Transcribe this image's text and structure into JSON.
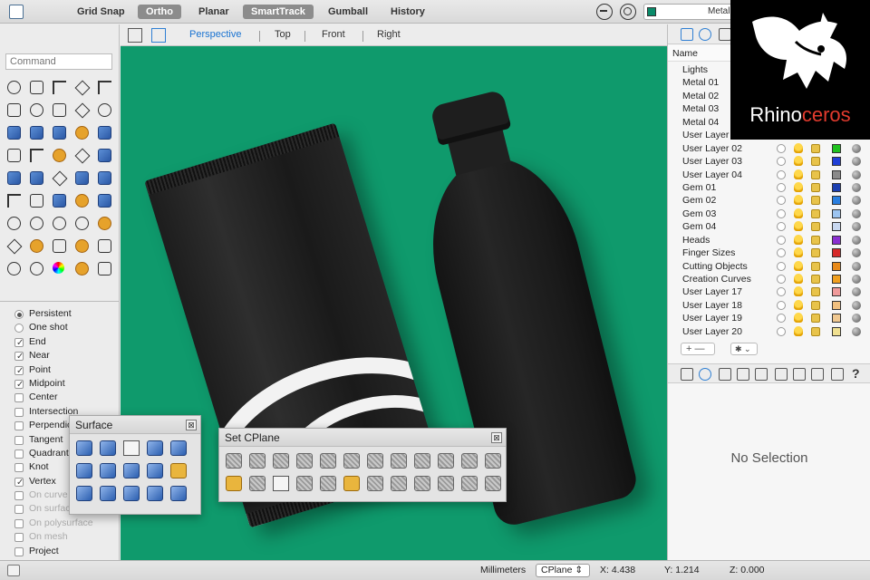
{
  "topbar": {
    "toggles": [
      {
        "label": "Grid Snap",
        "active": false
      },
      {
        "label": "Ortho",
        "active": true
      },
      {
        "label": "Planar",
        "active": false
      },
      {
        "label": "SmartTrack",
        "active": true
      },
      {
        "label": "Gumball",
        "active": false
      },
      {
        "label": "History",
        "active": false
      }
    ],
    "current_layer": "Metal",
    "current_layer_color": "#0a8b6a"
  },
  "command": {
    "placeholder": "Command"
  },
  "viewport_tabs": [
    "Perspective",
    "Top",
    "Front",
    "Right"
  ],
  "active_viewport": "Perspective",
  "osnap": {
    "modes": [
      {
        "label": "Persistent",
        "kind": "radio",
        "selected": true,
        "enabled": true
      },
      {
        "label": "One shot",
        "kind": "radio",
        "selected": false,
        "enabled": true
      },
      {
        "label": "End",
        "kind": "check",
        "selected": true,
        "enabled": true
      },
      {
        "label": "Near",
        "kind": "check",
        "selected": true,
        "enabled": true
      },
      {
        "label": "Point",
        "kind": "check",
        "selected": true,
        "enabled": true
      },
      {
        "label": "Midpoint",
        "kind": "check",
        "selected": true,
        "enabled": true
      },
      {
        "label": "Center",
        "kind": "check",
        "selected": false,
        "enabled": true
      },
      {
        "label": "Intersection",
        "kind": "check",
        "selected": false,
        "enabled": true
      },
      {
        "label": "Perpendicular",
        "kind": "check",
        "selected": false,
        "enabled": true
      },
      {
        "label": "Tangent",
        "kind": "check",
        "selected": false,
        "enabled": true
      },
      {
        "label": "Quadrant",
        "kind": "check",
        "selected": false,
        "enabled": true
      },
      {
        "label": "Knot",
        "kind": "check",
        "selected": false,
        "enabled": true
      },
      {
        "label": "Vertex",
        "kind": "check",
        "selected": true,
        "enabled": true
      },
      {
        "label": "On curve",
        "kind": "check",
        "selected": false,
        "enabled": false
      },
      {
        "label": "On surface",
        "kind": "check",
        "selected": false,
        "enabled": false
      },
      {
        "label": "On polysurface",
        "kind": "check",
        "selected": false,
        "enabled": false
      },
      {
        "label": "On mesh",
        "kind": "check",
        "selected": false,
        "enabled": false
      },
      {
        "label": "Project",
        "kind": "check",
        "selected": false,
        "enabled": true
      }
    ]
  },
  "surface_toolbar": {
    "title": "Surface",
    "close": "⊠"
  },
  "cplane_toolbar": {
    "title": "Set CPlane",
    "close": "⊠"
  },
  "layers": {
    "header": "Name",
    "items": [
      {
        "name": "Lights",
        "color": "",
        "show_controls": false
      },
      {
        "name": "Metal 01",
        "color": "",
        "show_controls": false
      },
      {
        "name": "Metal 02",
        "color": "",
        "show_controls": false
      },
      {
        "name": "Metal 03",
        "color": "",
        "show_controls": false
      },
      {
        "name": "Metal 04",
        "color": "",
        "show_controls": false
      },
      {
        "name": "User Layer 01",
        "color": "",
        "show_controls": false
      },
      {
        "name": "User Layer 02",
        "color": "#1fc21f",
        "show_controls": true
      },
      {
        "name": "User Layer 03",
        "color": "#1f3fd6",
        "show_controls": true
      },
      {
        "name": "User Layer 04",
        "color": "#8a8a8a",
        "show_controls": true
      },
      {
        "name": "Gem 01",
        "color": "#1c3fb0",
        "show_controls": true
      },
      {
        "name": "Gem 02",
        "color": "#2a7fe0",
        "show_controls": true
      },
      {
        "name": "Gem 03",
        "color": "#9cc4f0",
        "show_controls": true
      },
      {
        "name": "Gem 04",
        "color": "#c8d8f0",
        "show_controls": true
      },
      {
        "name": "Heads",
        "color": "#8a2fd0",
        "show_controls": true
      },
      {
        "name": "Finger Sizes",
        "color": "#d62a2a",
        "show_controls": true
      },
      {
        "name": "Cutting Objects",
        "color": "#e88a1a",
        "show_controls": true
      },
      {
        "name": "Creation Curves",
        "color": "#f0a020",
        "show_controls": true
      },
      {
        "name": "User Layer 17",
        "color": "#f09a9a",
        "show_controls": true
      },
      {
        "name": "User Layer 18",
        "color": "#f0c080",
        "show_controls": true
      },
      {
        "name": "User Layer 19",
        "color": "#f0c890",
        "show_controls": true
      },
      {
        "name": "User Layer 20",
        "color": "#f0e090",
        "show_controls": true
      }
    ],
    "add_remove": "+ —",
    "options": "✱ ⌄"
  },
  "properties": {
    "empty_text": "No Selection",
    "help": "?"
  },
  "logo": {
    "text_a": "Rhino",
    "text_b": "ceros"
  },
  "status": {
    "units": "Millimeters",
    "cplane": "CPlane",
    "x": "X: 4.438",
    "y": "Y: 1.214",
    "z": "Z: 0.000"
  }
}
